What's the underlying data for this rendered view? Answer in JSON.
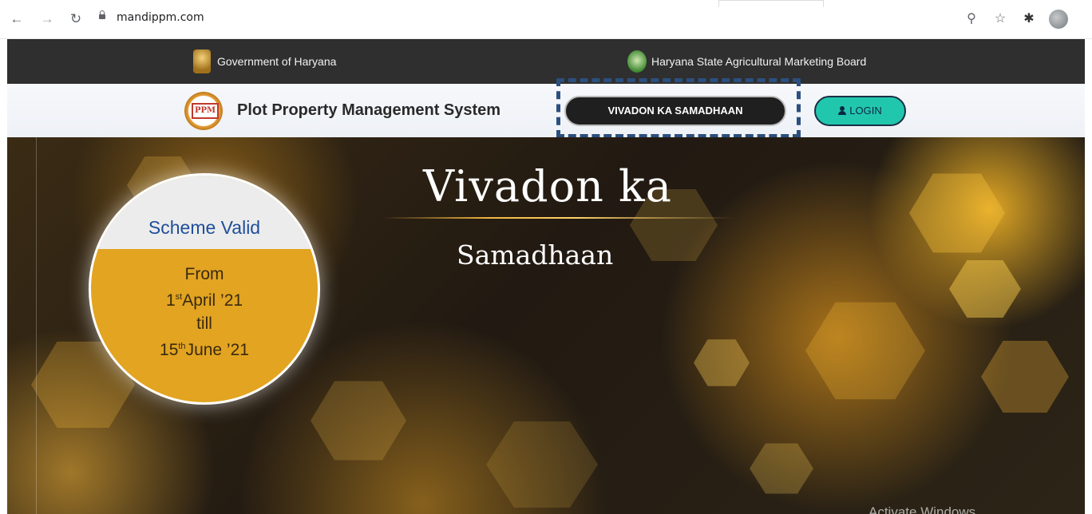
{
  "browser": {
    "url": "mandippm.com",
    "icons": [
      "back-arrow-icon",
      "forward-arrow-icon",
      "reload-icon",
      "lock-icon",
      "zoom-icon",
      "star-icon",
      "extensions-icon",
      "profile-avatar-icon"
    ]
  },
  "topbar": {
    "gov_label": "Government of Haryana",
    "board_label": "Haryana State Agricultural Marketing Board"
  },
  "header": {
    "logo_text": "PPM",
    "title": "Plot Property Management System",
    "vivadon_button": "VIVADON KA SAMADHAAN",
    "login_button": "LOGIN"
  },
  "hero": {
    "title": "Vivadon ka",
    "subtitle": "Samadhaan",
    "scheme": {
      "heading": "Scheme Valid",
      "from": "From",
      "start_day": "1",
      "start_sup": "st",
      "start_rest": "April ’21",
      "till": "till",
      "end_day": "15",
      "end_sup": "th",
      "end_rest": "June ’21"
    }
  },
  "watermark": "Activate Windows",
  "colors": {
    "topbar_bg": "#2f2f2f",
    "login_accent": "#21c7ad",
    "scheme_gold": "#e2a421",
    "scheme_heading": "#1f4e9a",
    "focus_dash": "#2b4f7e"
  }
}
